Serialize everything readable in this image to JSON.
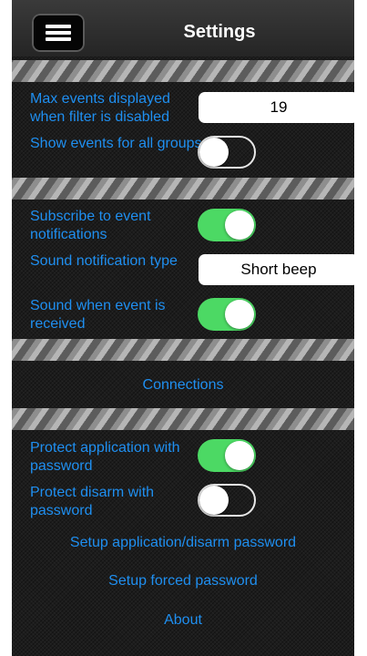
{
  "header": {
    "title": "Settings"
  },
  "section1": {
    "max_events_label": "Max events displayed when filter is disabled",
    "max_events_value": "19",
    "show_events_label": "Show events for all groups",
    "show_events_on": false
  },
  "section2": {
    "subscribe_label": "Subscribe to event notifications",
    "subscribe_on": true,
    "sound_type_label": "Sound notification type",
    "sound_type_value": "Short beep",
    "sound_event_label": "Sound when event is received",
    "sound_event_on": true
  },
  "connections": {
    "label": "Connections"
  },
  "section3": {
    "protect_app_label": "Protect application with password",
    "protect_app_on": true,
    "protect_disarm_label": "Protect disarm with password",
    "protect_disarm_on": false,
    "setup_password_label": "Setup application/disarm password",
    "setup_forced_label": "Setup forced password",
    "about_label": "About"
  },
  "colors": {
    "accent": "#1f8ff0",
    "toggle_on": "#4cd964",
    "background": "#1c1c1c"
  }
}
